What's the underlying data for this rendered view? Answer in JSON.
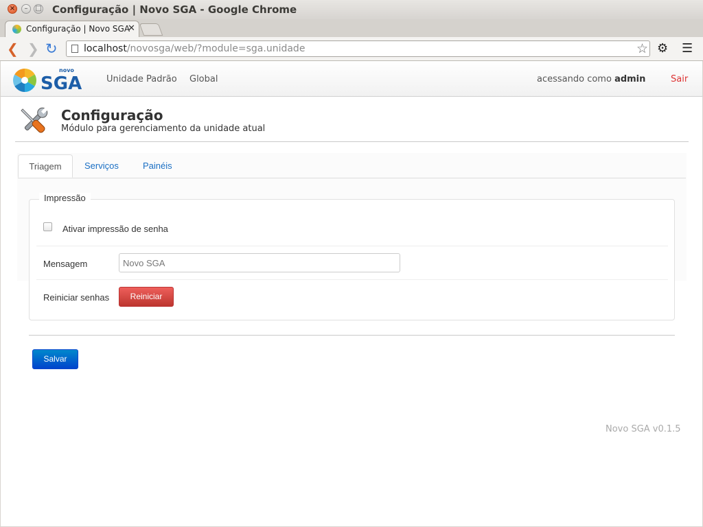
{
  "window": {
    "title": "Configuração | Novo SGA - Google Chrome"
  },
  "browser": {
    "tab_title": "Configuração | Novo SGA",
    "url_host": "localhost",
    "url_path": "/novosga/web/?module=sga.unidade"
  },
  "navbar": {
    "logo_small": "novo",
    "logo_big": "SGA",
    "links": [
      "Unidade Padrão",
      "Global"
    ],
    "access_prefix": "acessando como",
    "access_user": "admin",
    "logout": "Sair"
  },
  "header": {
    "title": "Configuração",
    "subtitle": "Módulo para gerenciamento da unidade atual"
  },
  "tabs": [
    {
      "label": "Triagem",
      "active": true
    },
    {
      "label": "Serviços",
      "active": false
    },
    {
      "label": "Painéis",
      "active": false
    }
  ],
  "form": {
    "legend": "Impressão",
    "checkbox_label": "Ativar impressão de senha",
    "checkbox_checked": false,
    "message_label": "Mensagem",
    "message_value": "Novo SGA",
    "reset_label": "Reiniciar senhas",
    "reset_button": "Reiniciar",
    "save_button": "Salvar"
  },
  "footer": {
    "version": "Novo SGA v0.1.5"
  },
  "colors": {
    "link": "#1a6fc4",
    "danger": "#d9403a",
    "primary": "#0066cc",
    "logout": "#dd3333"
  }
}
